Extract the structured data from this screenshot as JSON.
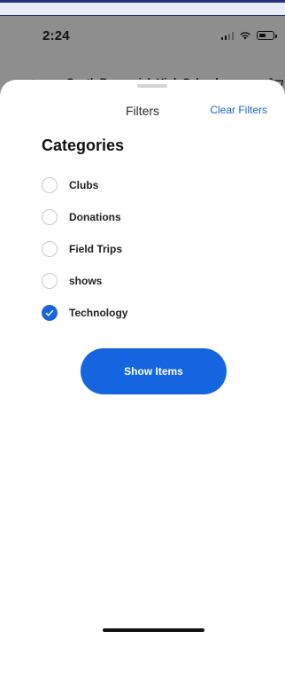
{
  "status_bar": {
    "time": "2:24",
    "battery_level": 0.55
  },
  "behind": {
    "title": "South Brunswick High School",
    "back_icon": "chevron-left-icon",
    "cart_icon": "cart-icon"
  },
  "sheet": {
    "title": "Filters",
    "clear_label": "Clear Filters",
    "section_title": "Categories",
    "categories": [
      {
        "label": "Clubs",
        "checked": false
      },
      {
        "label": "Donations",
        "checked": false
      },
      {
        "label": "Field Trips",
        "checked": false
      },
      {
        "label": "shows",
        "checked": false
      },
      {
        "label": "Technology",
        "checked": true
      }
    ],
    "show_items_label": "Show Items"
  },
  "colors": {
    "accent": "#1a63d8",
    "button": "#1565e0",
    "dim_background": "#8e8e8e"
  }
}
